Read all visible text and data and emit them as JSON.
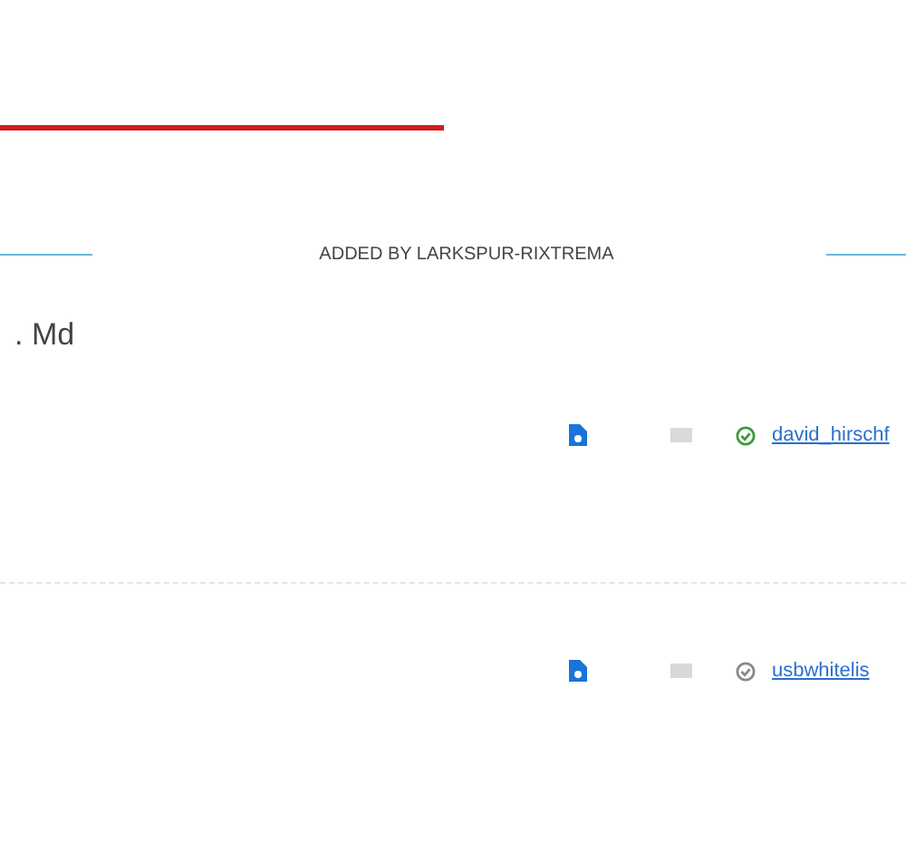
{
  "section": {
    "heading": "ADDED BY LARKSPUR-RIXTREMA",
    "title": ". Md"
  },
  "entries": [
    {
      "user": "david_hirschf",
      "verified": true
    },
    {
      "user": "usbwhitelis",
      "verified": false
    }
  ]
}
